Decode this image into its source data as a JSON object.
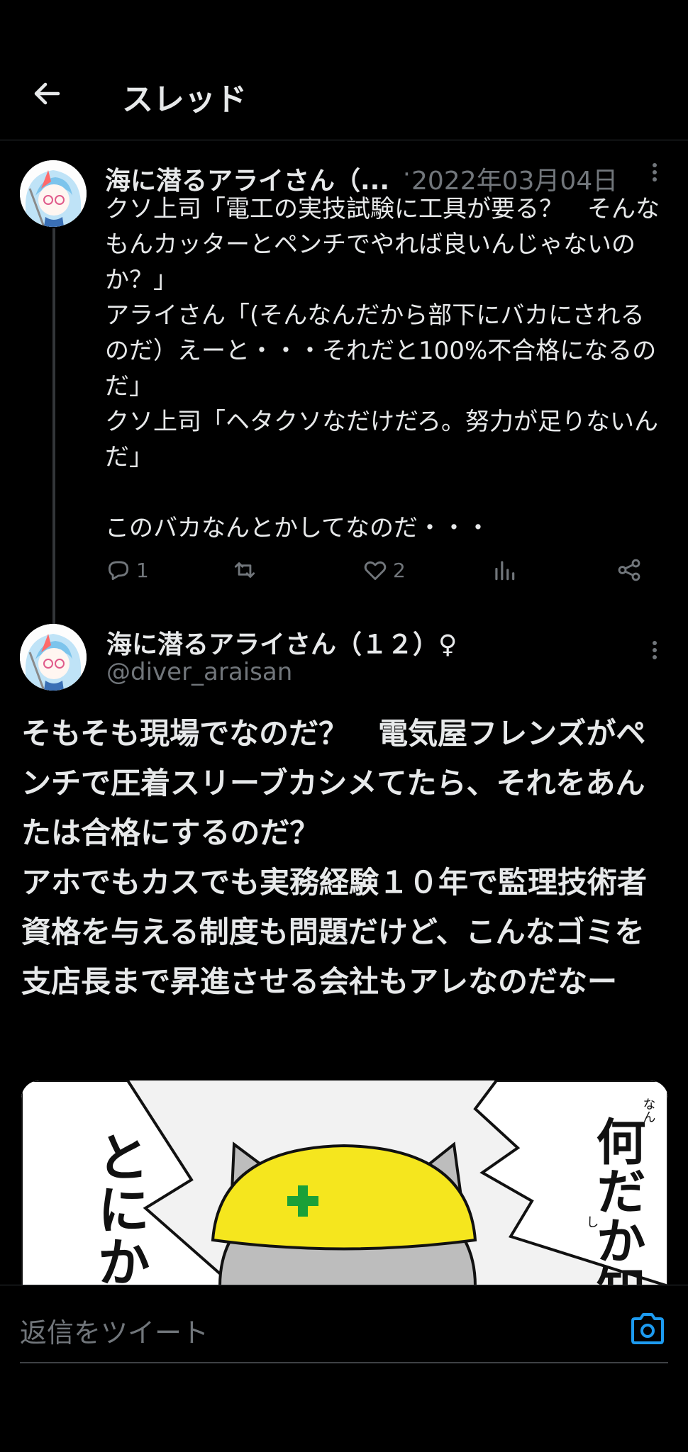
{
  "header": {
    "title": "スレッド"
  },
  "tweet1": {
    "author_name": "海に潜るアライさん（...",
    "separator": "·",
    "date": "2022年03月04日",
    "text": "クソ上司「電工の実技試験に工具が要る？　そんなもんカッターとペンチでやれば良いんじゃないのか？」\nアライさん「(そんなんだから部下にバカにされるのだ）えーと・・・それだと100%不合格になるのだ」\nクソ上司「ヘタクソなだけだろ。努力が足りないんだ」\n\nこのバカなんとかしてなのだ・・・",
    "actions": {
      "reply_count": "1",
      "like_count": "2"
    }
  },
  "tweet2": {
    "author_name": "海に潜るアライさん（１２）♀",
    "handle": "@diver_araisan",
    "text": "そもそも現場でなのだ？　電気屋フレンズがペンチで圧着スリーブカシメてたら、それをあんたは合格にするのだ？\nアホでもカスでも実務経験１０年で監理技術者資格を与える制度も問題だけど、こんなゴミを支店長まで昇進させる会社もアレなのだなー",
    "media": {
      "left_text": "とにかくヨシ",
      "right_text": "何だか知らんが",
      "ruby_nan": "なん",
      "ruby_shi": "し"
    }
  },
  "reply": {
    "placeholder": "返信をツイート"
  },
  "colors": {
    "background": "#000000",
    "text": "#e7e9ea",
    "muted": "#71767b",
    "accent": "#1d9bf0",
    "helmet": "#f5e61e"
  },
  "icons": [
    "back-arrow-icon",
    "more-icon",
    "reply-icon",
    "retweet-icon",
    "like-icon",
    "views-icon",
    "share-icon",
    "camera-icon"
  ]
}
